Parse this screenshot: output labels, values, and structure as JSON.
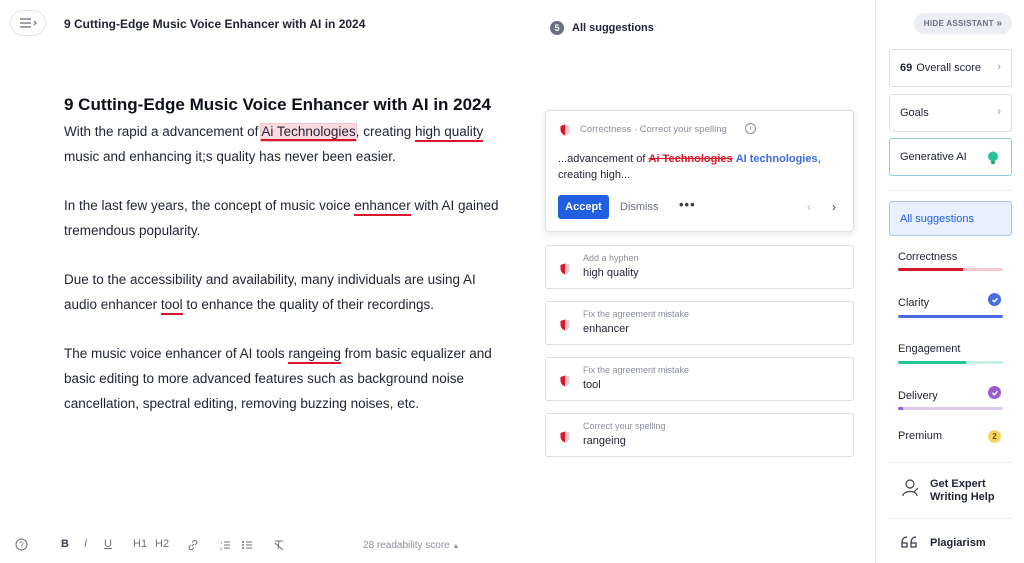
{
  "header": {
    "doc_title": "9 Cutting-Edge Music Voice Enhancer with AI in 2024",
    "suggestion_count": "5",
    "suggestions_title": "All suggestions"
  },
  "document": {
    "heading": "9 Cutting-Edge Music Voice Enhancer with AI in 2024",
    "p1": {
      "t1": "With the rapid a advancement of ",
      "e1": "Ai Technologies",
      "t2": ", creating ",
      "e2": "high quality",
      "t3": " music and enhancing it;s quality has never been easier."
    },
    "p2": {
      "t1": "In the last few years, the concept of music voice ",
      "e1": "enhancer",
      "t2": " with AI gained tremendous popularity."
    },
    "p3": {
      "t1": "Due to the accessibility and availability, many individuals are using AI audio enhancer ",
      "e1": "tool",
      "t2": " to enhance the quality of their recordings."
    },
    "p4": {
      "t1": "The music voice enhancer of AI tools ",
      "e1": "rangeing",
      "t2": " from basic equalizer and basic editing to more advanced features such as background noise cancellation, spectral editing, removing buzzing noises, etc."
    }
  },
  "toolbar": {
    "bold": "B",
    "italic": "I",
    "underline": "U",
    "h1": "H1",
    "h2": "H2",
    "readability": "28 readability score"
  },
  "active_suggestion": {
    "category": "Correctness · Correct your spelling",
    "prefix": "...advancement of ",
    "original": "Ai Technologies",
    "replacement": "AI technologies",
    "suffix": ", creating high...",
    "accept": "Accept",
    "dismiss": "Dismiss",
    "more": "•••"
  },
  "suggestions": [
    {
      "label": "Add a hyphen",
      "word": "high quality"
    },
    {
      "label": "Fix the agreement mistake",
      "word": "enhancer"
    },
    {
      "label": "Fix the agreement mistake",
      "word": "tool"
    },
    {
      "label": "Correct your spelling",
      "word": "rangeing"
    }
  ],
  "sidebar": {
    "hide_assistant": "HIDE ASSISTANT",
    "overall_score_value": "69",
    "overall_score_label": "Overall score",
    "goals": "Goals",
    "generative_ai": "Generative AI",
    "all_suggestions": "All suggestions",
    "categories": [
      {
        "name": "Correctness",
        "color": "#d9172c"
      },
      {
        "name": "Clarity",
        "color": "#4a6ee0"
      },
      {
        "name": "Engagement",
        "color": "#27c49a"
      },
      {
        "name": "Delivery",
        "color": "#9a5cd0"
      }
    ],
    "premium": "Premium",
    "premium_count": "2",
    "expert_line1": "Get Expert",
    "expert_line2": "Writing Help",
    "plagiarism": "Plagiarism"
  },
  "icons": {
    "menu": "menu-icon",
    "help": "help-icon",
    "link": "link-icon",
    "numbered_list": "numbered-list-icon",
    "bullet_list": "bullet-list-icon",
    "clear_format": "clear-format-icon",
    "shield": "shield-icon",
    "info": "info-icon",
    "bulb": "bulb-icon",
    "check": "check-icon",
    "expert": "expert-icon",
    "quote": "quote-icon"
  }
}
